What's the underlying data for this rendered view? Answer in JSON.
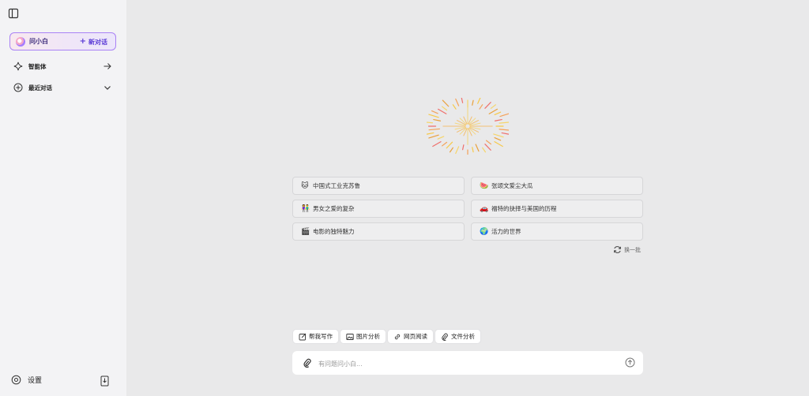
{
  "sidebar": {
    "toggle_icon": "sidebar-panel-icon",
    "brand": {
      "name": "问小白",
      "new_chat_label": "新对话",
      "accent": "#a982f5"
    },
    "agents": {
      "label": "智能体",
      "icon": "sparkle-icon",
      "end_icon": "arrow-right-icon"
    },
    "recent": {
      "label": "最近对话",
      "icon": "add-circle-icon",
      "end_icon": "chevron-down-icon"
    },
    "settings": {
      "label": "设置",
      "icon": "gear-icon"
    },
    "export_icon": "phone-download-icon"
  },
  "main": {
    "suggestions": [
      {
        "emoji": "🐱",
        "text": "中国式工业克苏鲁"
      },
      {
        "emoji": "🍉",
        "text": "张颂文爱尘大瓜"
      },
      {
        "emoji": "👫",
        "text": "男女之爱的复杂"
      },
      {
        "emoji": "🚗",
        "text": "福特的抉择与美国的历程"
      },
      {
        "emoji": "🎬",
        "text": "电影的独特魅力"
      },
      {
        "emoji": "🌍",
        "text": "活力的世界"
      }
    ],
    "refresh_label": "换一批",
    "tools": [
      {
        "label": "帮我写作",
        "icon": "edit-icon"
      },
      {
        "label": "图片分析",
        "icon": "image-icon"
      },
      {
        "label": "网页阅读",
        "icon": "link-icon"
      },
      {
        "label": "文件分析",
        "icon": "paperclip-icon"
      }
    ],
    "input": {
      "placeholder": "有问题问小白...",
      "value": ""
    }
  }
}
